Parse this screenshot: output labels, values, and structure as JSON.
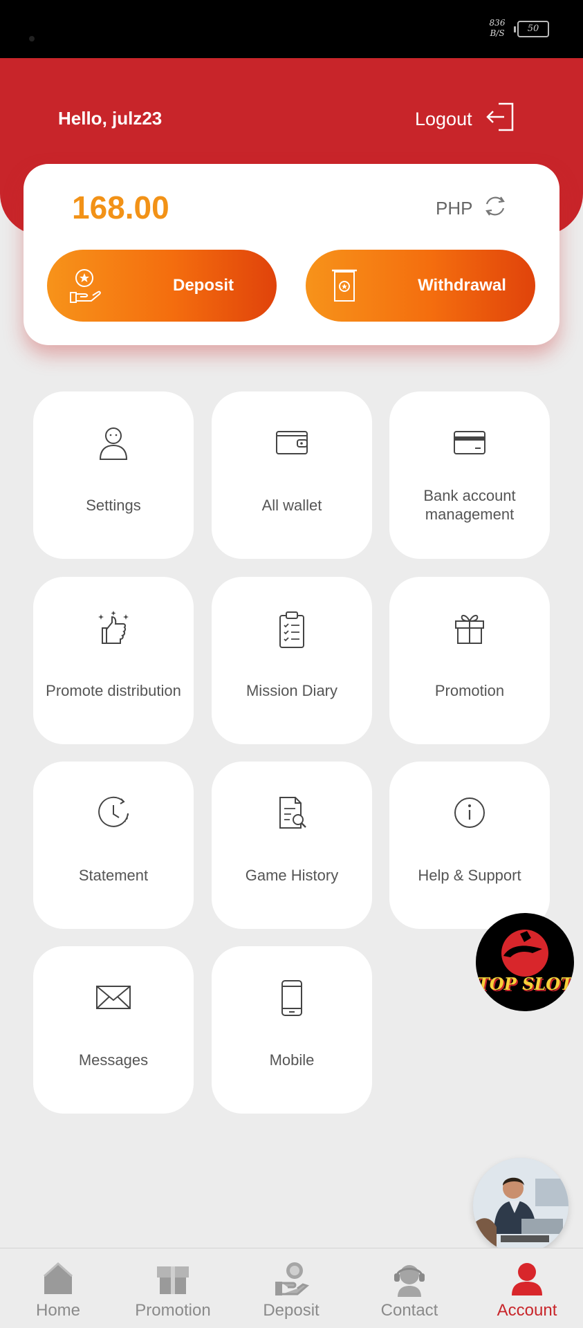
{
  "status_bar": {
    "net_speed": "836 B/S",
    "battery": "50"
  },
  "header": {
    "greeting": "Hello, julz23",
    "logout_label": "Logout"
  },
  "balance": {
    "amount": "168.00",
    "currency": "PHP",
    "deposit_label": "Deposit",
    "withdraw_label": "Withdrawal"
  },
  "menu": [
    {
      "label": "Settings",
      "icon": "user-icon"
    },
    {
      "label": "All wallet",
      "icon": "wallet-icon"
    },
    {
      "label": "Bank account management",
      "icon": "bank-card-icon"
    },
    {
      "label": "Promote distribution",
      "icon": "thumbs-up-icon"
    },
    {
      "label": "Mission Diary",
      "icon": "clipboard-icon"
    },
    {
      "label": "Promotion",
      "icon": "gift-icon"
    },
    {
      "label": "Statement",
      "icon": "clock-icon"
    },
    {
      "label": "Game History",
      "icon": "document-search-icon"
    },
    {
      "label": "Help & Support",
      "icon": "info-icon"
    },
    {
      "label": "Messages",
      "icon": "envelope-icon"
    },
    {
      "label": "Mobile",
      "icon": "mobile-phone-icon"
    }
  ],
  "floating": {
    "topslot_text": "TOP SLOT"
  },
  "bottom_nav": [
    {
      "label": "Home",
      "icon": "home-icon",
      "active": false
    },
    {
      "label": "Promotion",
      "icon": "gift-box-icon",
      "active": false
    },
    {
      "label": "Deposit",
      "icon": "deposit-icon",
      "active": false
    },
    {
      "label": "Contact",
      "icon": "headset-icon",
      "active": false
    },
    {
      "label": "Account",
      "icon": "account-icon",
      "active": true
    }
  ],
  "colors": {
    "brand_red": "#c8252a",
    "amount_orange": "#f29217",
    "button_gradient_start": "#f7931a",
    "button_gradient_end": "#e0430b"
  }
}
